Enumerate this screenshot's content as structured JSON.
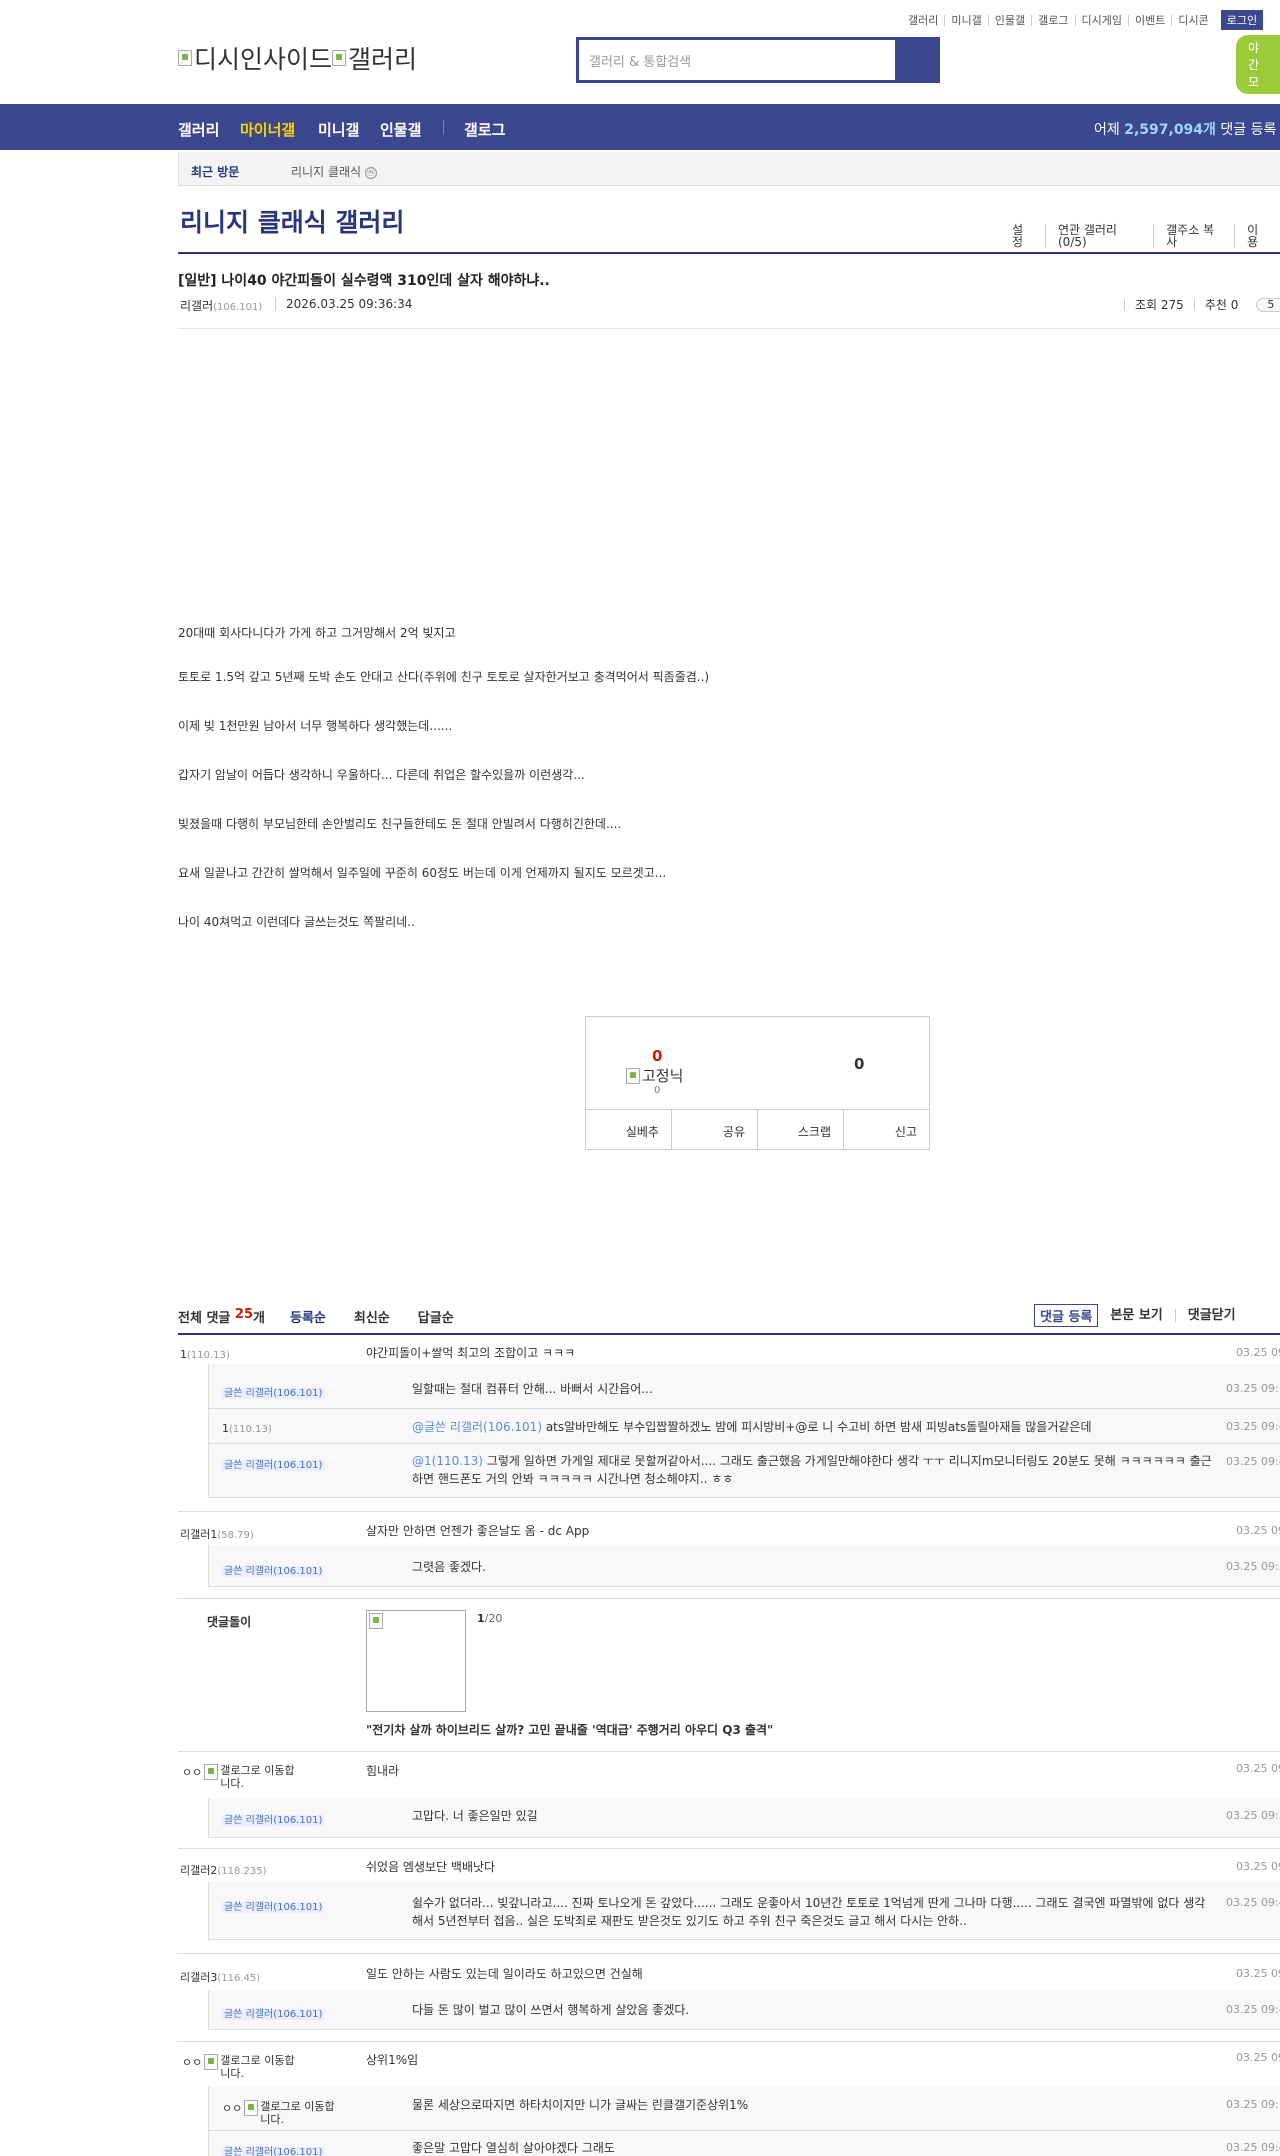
{
  "top_links": [
    "갤러리",
    "미니갤",
    "인물갤",
    "갤로그",
    "디시게임",
    "이벤트",
    "디시콘"
  ],
  "login_label": "로그인",
  "night_label": "야간 모",
  "logo_text": "디시인사이드",
  "logo_sub": "갤러리",
  "search": {
    "placeholder": "갤러리 & 통합검색"
  },
  "gnb": {
    "items": [
      "갤러리",
      "마이너갤",
      "미니갤",
      "인물갤",
      "갤로그"
    ],
    "yesterday_prefix": "어제",
    "yesterday_count": "2,597,094개",
    "yesterday_suffix": "댓글 등록"
  },
  "recent": {
    "label": "최근 방문",
    "gallery": "리니지 클래식"
  },
  "gallery": {
    "title": "리니지 클래식 갤러리",
    "tools": [
      "설정",
      "연관 갤러리(0/5)",
      "갤주소 복사",
      "이용"
    ]
  },
  "post": {
    "title": "[일반] 나이40 야간피돌이 실수령액 310인데 살자 해야하냐..",
    "writer": "리갤러",
    "writer_ip": "(106.101)",
    "date": "2026.03.25 09:36:34",
    "views": "조회 275",
    "recommends": "추천 0",
    "comment_count_pill": "5",
    "body": [
      "20대때 회사다니다가 가게 하고 그거망해서 2억 빚지고",
      "토토로 1.5억 갚고 5년째 도박 손도 안대고 산다(주위에 친구 토토로 살자한거보고 충격먹어서 픽좀줄겸..)",
      "이제 빚 1천만원 남아서 너무 행복하다 생각했는데......",
      "갑자기 암날이 어듭다 생각하니 우울하다... 다른데 취업은 할수있을까 이런생각...",
      "빚졌을때 다행히 부모님한테 손안벌리도 친구들한테도 돈 절대 안빌려서 다행히긴한데....",
      "요새 일끝나고 간간히 쌀먹해서 일주일에 꾸준히 60정도  버는데 이게 언제까지 될지도 모르겟고...",
      "나이 40쳐먹고 이런데다 글쓰는것도 쪽팔리네.."
    ]
  },
  "recommend": {
    "up_count": "0",
    "fixed_label": "고정닉",
    "fixed_count": "0",
    "down_count": "0",
    "buttons": [
      "실베추",
      "공유",
      "스크랩",
      "신고"
    ]
  },
  "comments_header": {
    "total_label": "전체 댓글",
    "total_count": "25",
    "total_unit": "개",
    "sort_tabs": [
      "등록순",
      "최신순",
      "답글순"
    ],
    "register": "댓글 등록",
    "view_body": "본문 보기",
    "close": "댓글닫기"
  },
  "comments": [
    {
      "name": "1",
      "ip": "(110.13)",
      "text": "야간피돌이+쌀먹 최고의 조합이고 ㅋㅋㅋ",
      "date": "03.25 09"
    },
    {
      "reply": true,
      "name": "글쓴 리갤러",
      "ip": "(106.101)",
      "text": "일할때는 절대 컴퓨터 안해... 바뻐서 시간읍어...",
      "date": "03.25 09:"
    },
    {
      "reply": true,
      "name": "1",
      "ip": "(110.13)",
      "mention": "@글쓴 리갤러(106.101)",
      "text": " ats알바만해도 부수입짭짤하겠노 밤에 피시방비+@로 니 수고비 하면 밤새 피빙ats돌릴아재들 많을거같은데",
      "date": "03.25 09:4"
    },
    {
      "reply": true,
      "name": "글쓴 리갤러",
      "ip": "(106.101)",
      "mention": "@1(110.13)",
      "text": " 그렇게 일하면 가게일 제대로 못할꺼같아서.... 그래도 출근했음 가게일만해야한다 생각 ㅜㅜ 리니지m모니터링도 20분도 못해 ㅋㅋㅋㅋㅋㅋ 출근하면 핸드폰도 거의 안봐 ㅋㅋㅋㅋㅋ 시간나면 청소해야지.. ㅎㅎ",
      "date": "03.25 09:4"
    },
    {
      "name": "리갤러1",
      "ip": "(58.79)",
      "text": "살자만 안하면 언젠가 좋은날도 옴 - dc App",
      "date": "03.25 09"
    },
    {
      "reply": true,
      "name": "글쓴 리갤러",
      "ip": "(106.101)",
      "text": "그렷음 좋겠다.",
      "date": "03.25 09:3"
    },
    {
      "name": "ㅇㅇ",
      "gallog": "갤로그로 이동합니다.",
      "text": "힘내라",
      "date": "03.25 09"
    },
    {
      "reply": true,
      "name": "글쓴 리갤러",
      "ip": "(106.101)",
      "text": "고맙다. 너 좋은일만 있길",
      "date": "03.25 09:3"
    },
    {
      "name": "리갤러2",
      "ip": "(118.235)",
      "text": "쉬었음 엠생보단 백배낫다",
      "date": "03.25 09"
    },
    {
      "reply": true,
      "name": "글쓴 리갤러",
      "ip": "(106.101)",
      "text": "쉴수가 없더라... 빚갚니라고.... 진짜 토나오게 돈 갚았다...... 그래도 운좋아서 10년간 토토로 1억넘게 딴게 그나마 다행..... 그래도 결국엔 파멸밖에 없다 생각해서 5년전부터 접음.. 실은 도박죄로 재판도 받은것도 있기도 하고 주위 친구 죽은것도 글고 해서 다시는 안하..",
      "date": "03.25 09:4"
    },
    {
      "name": "리갤러3",
      "ip": "(116.45)",
      "text": "일도 안하는 사람도 있는데 일이라도 하고있으면 건실해",
      "date": "03.25 09"
    },
    {
      "reply": true,
      "name": "글쓴 리갤러",
      "ip": "(106.101)",
      "text": "다들 돈 많이 벌고 많이 쓰면서 행복하게 살았음 좋겠다.",
      "date": "03.25 09:4"
    },
    {
      "name": "ㅇㅇ",
      "gallog": "갤로그로 이동합니다.",
      "text": "상위1%임",
      "date": "03.25 09"
    },
    {
      "reply": true,
      "name": "ㅇㅇ",
      "gallog": "갤로그로 이동합니다.",
      "text": "물론 세상으로따지면 하타치이지만 니가 글싸는 린클갤기준상위1%",
      "date": "03.25 09:"
    },
    {
      "reply": true,
      "name": "글쓴 리갤러",
      "ip": "(106.101)",
      "text": "좋은말 고맙다 열심히 살아야겠다 그래도",
      "date": "03.25 09:4"
    }
  ],
  "ad": {
    "name": "댓글돌이",
    "count": "1",
    "total": "/20",
    "title": "\"전기차 살까 하이브리드 살까? 고민 끝내줄 '역대급' 주행거리 아우디 Q3 출격\""
  }
}
